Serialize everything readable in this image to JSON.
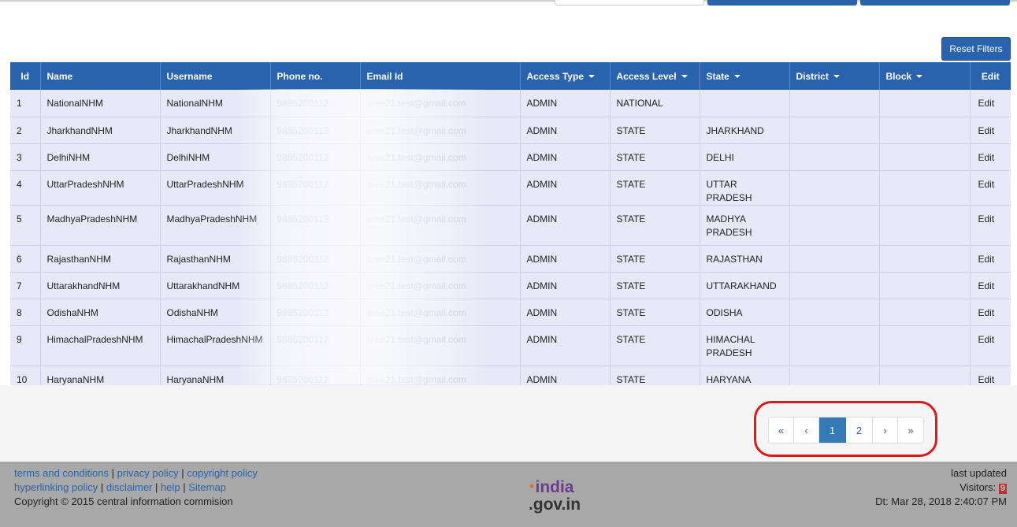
{
  "toolbar": {
    "reset_filters_label": "Reset Filters"
  },
  "table": {
    "columns": [
      {
        "label": "Id",
        "sortable": false
      },
      {
        "label": "Name",
        "sortable": false
      },
      {
        "label": "Username",
        "sortable": false
      },
      {
        "label": "Phone no.",
        "sortable": false
      },
      {
        "label": "Email Id",
        "sortable": false
      },
      {
        "label": "Access Type",
        "sortable": true
      },
      {
        "label": "Access Level",
        "sortable": true
      },
      {
        "label": "State",
        "sortable": true
      },
      {
        "label": "District",
        "sortable": true
      },
      {
        "label": "Block",
        "sortable": true
      },
      {
        "label": "Edit",
        "sortable": false
      }
    ],
    "rows": [
      {
        "id": "1",
        "name": "NationalNHM",
        "username": "NationalNHM",
        "phone": "9885200112",
        "email": "sree21.test@gmail.com",
        "access_type": "ADMIN",
        "access_level": "NATIONAL",
        "state": "",
        "district": "",
        "block": "",
        "edit": "Edit"
      },
      {
        "id": "2",
        "name": "JharkhandNHM",
        "username": "JharkhandNHM",
        "phone": "9885200112",
        "email": "sree21.test@gmail.com",
        "access_type": "ADMIN",
        "access_level": "STATE",
        "state": "JHARKHAND",
        "district": "",
        "block": "",
        "edit": "Edit"
      },
      {
        "id": "3",
        "name": "DelhiNHM",
        "username": "DelhiNHM",
        "phone": "9885200112",
        "email": "sree21.test@gmail.com",
        "access_type": "ADMIN",
        "access_level": "STATE",
        "state": "DELHI",
        "district": "",
        "block": "",
        "edit": "Edit"
      },
      {
        "id": "4",
        "name": "UttarPradeshNHM",
        "username": "UttarPradeshNHM",
        "phone": "9885200112",
        "email": "sree21.test@gmail.com",
        "access_type": "ADMIN",
        "access_level": "STATE",
        "state": "UTTAR PRADESH",
        "district": "",
        "block": "",
        "edit": "Edit"
      },
      {
        "id": "5",
        "name": "MadhyaPradeshNHM",
        "username": "MadhyaPradeshNHM",
        "phone": "9885200112",
        "email": "sree21.test@gmail.com",
        "access_type": "ADMIN",
        "access_level": "STATE",
        "state": "MADHYA PRADESH",
        "district": "",
        "block": "",
        "edit": "Edit"
      },
      {
        "id": "6",
        "name": "RajasthanNHM",
        "username": "RajasthanNHM",
        "phone": "9885200112",
        "email": "sree21.test@gmail.com",
        "access_type": "ADMIN",
        "access_level": "STATE",
        "state": "RAJASTHAN",
        "district": "",
        "block": "",
        "edit": "Edit"
      },
      {
        "id": "7",
        "name": "UttarakhandNHM",
        "username": "UttarakhandNHM",
        "phone": "9885200112",
        "email": "sree21.test@gmail.com",
        "access_type": "ADMIN",
        "access_level": "STATE",
        "state": "UTTARAKHAND",
        "district": "",
        "block": "",
        "edit": "Edit"
      },
      {
        "id": "8",
        "name": "OdishaNHM",
        "username": "OdishaNHM",
        "phone": "9885200112",
        "email": "sree21.test@gmail.com",
        "access_type": "ADMIN",
        "access_level": "STATE",
        "state": "ODISHA",
        "district": "",
        "block": "",
        "edit": "Edit"
      },
      {
        "id": "9",
        "name": "HimachalPradeshNHM",
        "username": "HimachalPradeshNHM",
        "phone": "9885200112",
        "email": "sree21.test@gmail.com",
        "access_type": "ADMIN",
        "access_level": "STATE",
        "state": "HIMACHAL PRADESH",
        "district": "",
        "block": "",
        "edit": "Edit"
      },
      {
        "id": "10",
        "name": "HaryanaNHM",
        "username": "HaryanaNHM",
        "phone": "9885200112",
        "email": "sree21.test@gmail.com",
        "access_type": "ADMIN",
        "access_level": "STATE",
        "state": "HARYANA",
        "district": "",
        "block": "",
        "edit": "Edit"
      }
    ]
  },
  "pagination": {
    "first": "«",
    "prev": "‹",
    "pages": [
      "1",
      "2"
    ],
    "active_page": "1",
    "next": "›",
    "last": "»"
  },
  "footer": {
    "links_line1": [
      "terms and conditions",
      "privacy policy",
      "copyright policy"
    ],
    "links_line2": [
      "hyperlinking policy",
      "disclaimer",
      "help",
      "Sitemap"
    ],
    "separator": "|",
    "copyright": "Copyright © 2015 central information commision",
    "last_updated_label": "last updated",
    "visitors_label": "Visitors:",
    "visitors_count": "9",
    "date_time": "Dt: Mar 28, 2018 2:40:07 PM",
    "logo_text_top": "india",
    "logo_text_bottom": ".gov.in"
  },
  "colors": {
    "header_blue": "#2a63ad",
    "row_bg": "#e7e9f8",
    "footer_bg": "#a8a8a8",
    "highlight_red": "#e01a1a",
    "active_page": "#337ab7"
  }
}
